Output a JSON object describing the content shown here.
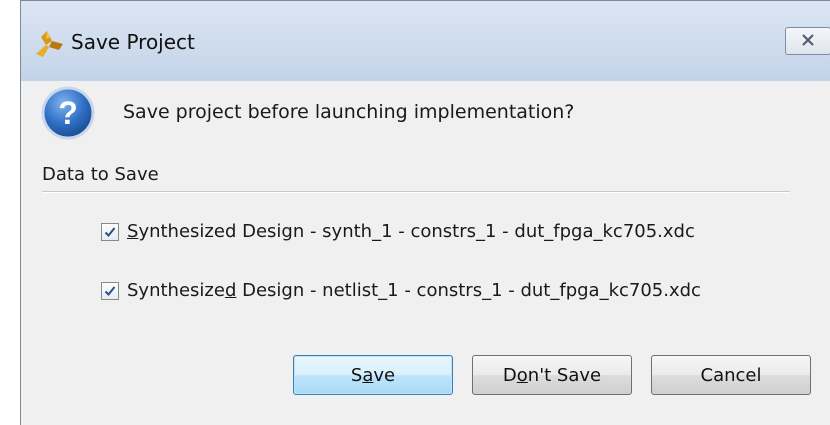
{
  "window": {
    "title": "Save Project",
    "app_icon": "app-logo-icon",
    "close_icon": "close-icon"
  },
  "message": {
    "icon": "question-icon",
    "text": "Save project before launching implementation?"
  },
  "section": {
    "label": "Data to Save"
  },
  "items": [
    {
      "checked": true,
      "mnemonic_pre": "",
      "mnemonic": "S",
      "mnemonic_post": "ynthesized Design - synth_1 - constrs_1 - dut_fpga_kc705.xdc"
    },
    {
      "checked": true,
      "mnemonic_pre": "Synthesize",
      "mnemonic": "d",
      "mnemonic_post": " Design - netlist_1 - constrs_1 - dut_fpga_kc705.xdc"
    }
  ],
  "buttons": {
    "save": {
      "pre": "S",
      "mnemonic": "a",
      "post": "ve"
    },
    "dont_save": {
      "pre": "D",
      "mnemonic": "o",
      "post": "n't Save"
    },
    "cancel": {
      "label": "Cancel"
    }
  },
  "colors": {
    "title_gradient_top": "#dbe6f3",
    "body_bg": "#f0f0f0",
    "default_button": "#bee6fd",
    "question_icon": "#2f6fc4"
  }
}
